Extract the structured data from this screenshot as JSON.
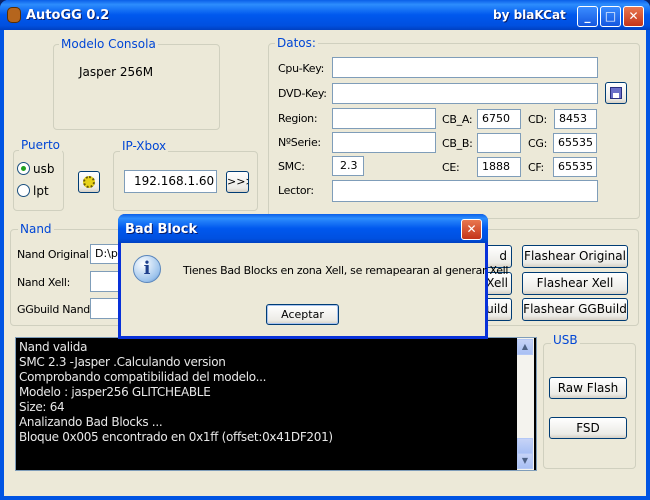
{
  "window": {
    "title": "AutoGG 0.2",
    "author": "by blaKCat",
    "minimize": "_",
    "maximize": "□",
    "close": "✕"
  },
  "modelo": {
    "legend": "Modelo Consola",
    "value": "Jasper 256M"
  },
  "datos": {
    "legend": "Datos:",
    "cpu_key": {
      "label": "Cpu-Key:",
      "value": ""
    },
    "dvd_key": {
      "label": "DVD-Key:",
      "value": ""
    },
    "region": {
      "label": "Region:",
      "value": ""
    },
    "serie": {
      "label": "NºSerie:",
      "value": ""
    },
    "smc": {
      "label": "SMC:",
      "value": "2.3"
    },
    "lector": {
      "label": "Lector:",
      "value": ""
    },
    "cb_a": {
      "label": "CB_A:",
      "value": "6750"
    },
    "cb_b": {
      "label": "CB_B:",
      "value": ""
    },
    "ce": {
      "label": "CE:",
      "value": "1888"
    },
    "cd": {
      "label": "CD:",
      "value": "8453"
    },
    "cg": {
      "label": "CG:",
      "value": "65535"
    },
    "cf": {
      "label": "CF:",
      "value": "65535"
    }
  },
  "puerto": {
    "legend": "Puerto",
    "usb": "usb",
    "lpt": "lpt",
    "selected": "usb"
  },
  "ip": {
    "legend": "IP-Xbox",
    "value": "192.168.1.60",
    "go": ">>>"
  },
  "nand": {
    "legend": "Nand",
    "original": {
      "label": "Nand Original:",
      "value": "D:\\p:"
    },
    "xell": {
      "label": "Nand Xell:",
      "value": ""
    },
    "ggbuild": {
      "label": "GGbuild Nand:",
      "value": ""
    },
    "hidden_buttons": [
      "d",
      "Xell",
      "uild"
    ],
    "flash_original": "Flashear Original",
    "flash_xell": "Flashear Xell",
    "flash_ggbuild": "Flashear GGBuild"
  },
  "log": [
    "Nand valida",
    "SMC 2.3 -Jasper .Calculando version",
    "Comprobando compatibilidad del modelo...",
    "Modelo : jasper256 GLITCHEABLE",
    "Size: 64",
    "Analizando Bad Blocks ...",
    "Bloque 0x005 encontrado en 0x1ff (offset:0x41DF201)"
  ],
  "usb": {
    "legend": "USB",
    "raw_flash": "Raw Flash",
    "fsd": "FSD"
  },
  "dialog": {
    "title": "Bad Block",
    "message": "Tienes Bad Blocks en zona Xell, se remapearan al generar Xell",
    "ok": "Aceptar",
    "close": "✕"
  }
}
